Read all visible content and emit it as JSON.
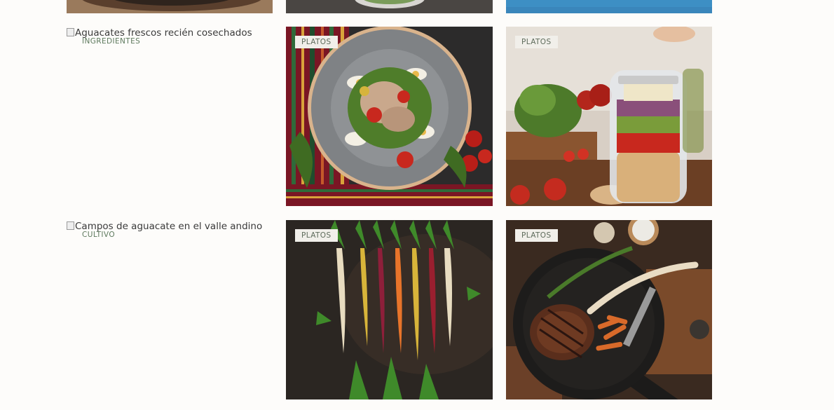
{
  "gallery": {
    "items": [
      {
        "alt": "",
        "tag": ""
      },
      {
        "alt": "",
        "tag": ""
      },
      {
        "alt": "",
        "tag": ""
      },
      {
        "alt": "Aguacates frescos recién cosechados",
        "tag": "INGREDIENTES"
      },
      {
        "alt": "",
        "tag": "PLATOS"
      },
      {
        "alt": "",
        "tag": "PLATOS"
      },
      {
        "alt": "Campos de aguacate en el valle andino",
        "tag": "CULTIVO"
      },
      {
        "alt": "",
        "tag": "PLATOS"
      },
      {
        "alt": "",
        "tag": "PLATOS"
      }
    ]
  },
  "colors": {
    "background": "#fdfcfa",
    "tag_background": "#f1efea",
    "tag_text": "#5e6b5b",
    "category_text": "#5e7a5e"
  },
  "icons": [
    "broken-image-icon"
  ]
}
